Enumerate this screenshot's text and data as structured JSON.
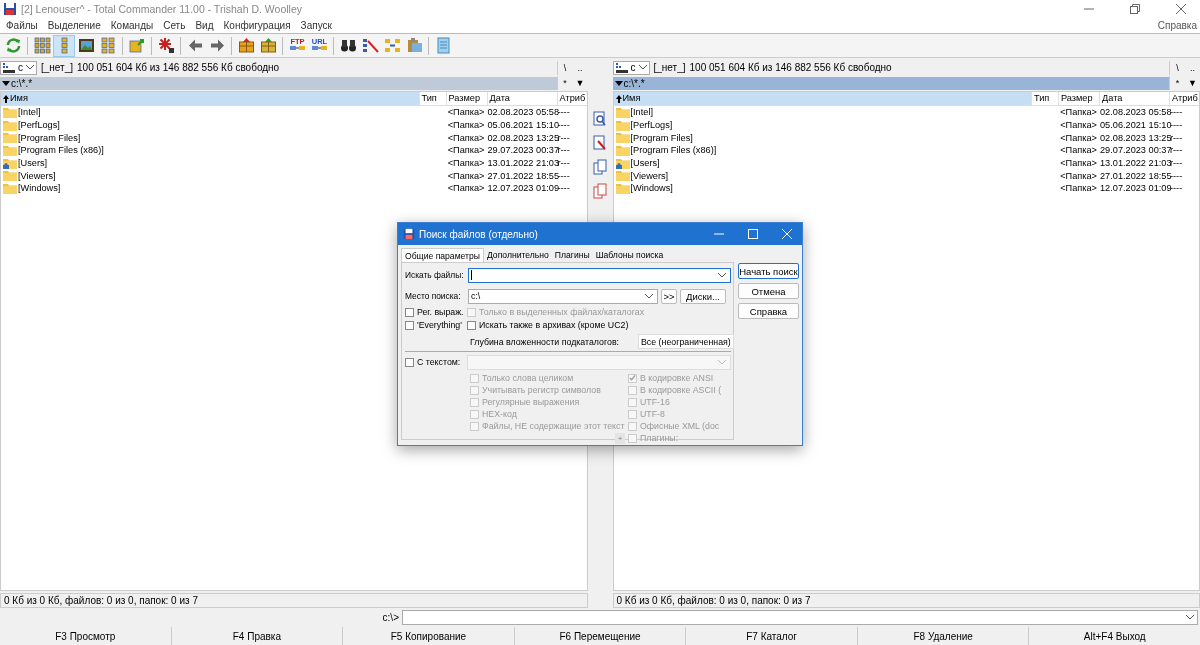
{
  "window": {
    "title": "[2] Lenouser^ - Total Commander 11.00 - Trishah D. Woolley"
  },
  "menu": [
    "Файлы",
    "Выделение",
    "Команды",
    "Сеть",
    "Вид",
    "Конфигурация",
    "Запуск"
  ],
  "help_menu": "Справка",
  "toolbar": [
    {
      "kind": "refresh",
      "selected": false
    },
    {
      "kind": "separator"
    },
    {
      "kind": "brief",
      "selected": false
    },
    {
      "kind": "detailed",
      "selected": true
    },
    {
      "kind": "thumbs",
      "selected": false
    },
    {
      "kind": "tree",
      "selected": false
    },
    {
      "kind": "separator"
    },
    {
      "kind": "syncfolder",
      "selected": false
    },
    {
      "kind": "separator"
    },
    {
      "kind": "rename",
      "selected": false
    },
    {
      "kind": "separator"
    },
    {
      "kind": "back",
      "selected": false
    },
    {
      "kind": "forward",
      "selected": false
    },
    {
      "kind": "separator"
    },
    {
      "kind": "pack",
      "selected": false
    },
    {
      "kind": "unpack",
      "selected": false
    },
    {
      "kind": "separator"
    },
    {
      "kind": "ftp",
      "label": "FTP",
      "selected": false
    },
    {
      "kind": "url",
      "label": "URL",
      "selected": false
    },
    {
      "kind": "separator"
    },
    {
      "kind": "find",
      "selected": false
    },
    {
      "kind": "compare",
      "selected": false
    },
    {
      "kind": "syncdirs",
      "selected": false
    },
    {
      "kind": "copynames",
      "selected": false
    },
    {
      "kind": "separator"
    },
    {
      "kind": "notepad",
      "selected": false
    }
  ],
  "panels": [
    {
      "active": false,
      "drive": "c",
      "volume": "[_нет_]",
      "free": "100 051 604 Кб из 146 882 556 Кб свободно",
      "root_button": "\\",
      "up_button": "..",
      "path": "c:\\*.*",
      "star_button": "*",
      "history_button": "▼",
      "columns": [
        "Имя",
        "Тип",
        "Размер",
        "Дата",
        "Атриб"
      ],
      "rows": [
        {
          "kind": "folder",
          "name": "[Intel]",
          "size": "<Папка>",
          "date": "02.08.2023 05:58",
          "attr": "----"
        },
        {
          "kind": "folder",
          "name": "[PerfLogs]",
          "size": "<Папка>",
          "date": "05.06.2021 15:10",
          "attr": "----"
        },
        {
          "kind": "folder",
          "name": "[Program Files]",
          "size": "<Папка>",
          "date": "02.08.2023 13:25",
          "attr": "r---"
        },
        {
          "kind": "folder",
          "name": "[Program Files (x86)]",
          "size": "<Папка>",
          "date": "29.07.2023 00:37",
          "attr": "r---"
        },
        {
          "kind": "user-folder",
          "name": "[Users]",
          "size": "<Папка>",
          "date": "13.01.2022 21:03",
          "attr": "r---"
        },
        {
          "kind": "folder",
          "name": "[Viewers]",
          "size": "<Папка>",
          "date": "27.01.2022 18:55",
          "attr": "----"
        },
        {
          "kind": "folder",
          "name": "[Windows]",
          "size": "<Папка>",
          "date": "12.07.2023 01:09",
          "attr": "----"
        }
      ],
      "status": "0 Кб из 0 Кб, файлов: 0 из 0, папок: 0 из 7"
    },
    {
      "active": true,
      "drive": "c",
      "volume": "[_нет_]",
      "free": "100 051 604 Кб из 146 882 556 Кб свободно",
      "root_button": "\\",
      "up_button": "..",
      "path": "c:\\*.*",
      "star_button": "*",
      "history_button": "▼",
      "columns": [
        "Имя",
        "Тип",
        "Размер",
        "Дата",
        "Атриб"
      ],
      "rows": [
        {
          "kind": "folder",
          "name": "[Intel]",
          "size": "<Папка>",
          "date": "02.08.2023 05:58",
          "attr": "----"
        },
        {
          "kind": "folder",
          "name": "[PerfLogs]",
          "size": "<Папка>",
          "date": "05.06.2021 15:10",
          "attr": "----"
        },
        {
          "kind": "folder",
          "name": "[Program Files]",
          "size": "<Папка>",
          "date": "02.08.2023 13:25",
          "attr": "r---"
        },
        {
          "kind": "folder",
          "name": "[Program Files (x86)]",
          "size": "<Папка>",
          "date": "29.07.2023 00:37",
          "attr": "r---"
        },
        {
          "kind": "user-folder",
          "name": "[Users]",
          "size": "<Папка>",
          "date": "13.01.2022 21:03",
          "attr": "r---"
        },
        {
          "kind": "folder",
          "name": "[Viewers]",
          "size": "<Папка>",
          "date": "27.01.2022 18:55",
          "attr": "----"
        },
        {
          "kind": "folder",
          "name": "[Windows]",
          "size": "<Папка>",
          "date": "12.07.2023 01:09",
          "attr": "----"
        }
      ],
      "status": "0 Кб из 0 Кб, файлов: 0 из 0, папок: 0 из 7"
    }
  ],
  "command_line": {
    "prompt": "c:\\>"
  },
  "function_keys": [
    "F3 Просмотр",
    "F4 Правка",
    "F5 Копирование",
    "F6 Перемещение",
    "F7 Каталог",
    "F8 Удаление",
    "Alt+F4 Выход"
  ],
  "dialog": {
    "title": "Поиск файлов (отдельно)",
    "tabs": [
      {
        "label": "Общие параметры",
        "selected": true
      },
      {
        "label": "Дополнительно",
        "selected": false
      },
      {
        "label": "Плагины",
        "selected": false
      },
      {
        "label": "Шаблоны поиска",
        "selected": false
      }
    ],
    "search_for": {
      "label": "Искать файлы:"
    },
    "search_in": {
      "label": "Место поиска:",
      "value": "c:\\"
    },
    "more_button": ">>",
    "drives_button": "Диски...",
    "left_checks": [
      {
        "label": "Рег. выраж.",
        "checked": false,
        "disabled": false
      },
      {
        "label": "'Everything'",
        "checked": false,
        "disabled": false
      }
    ],
    "right_checks": [
      {
        "label": "Только в выделенных файлах/каталогах",
        "checked": false,
        "disabled": true
      },
      {
        "label": "Искать также в архивах (кроме UC2)",
        "checked": false,
        "disabled": false
      }
    ],
    "depth": {
      "label": "Глубина вложенности подкаталогов:",
      "value": "Все (неограниченная)"
    },
    "text_check": {
      "label": "С текстом:",
      "checked": false,
      "disabled": false
    },
    "text_options": [
      {
        "label": "Только слова целиком",
        "checked": false,
        "disabled": true
      },
      {
        "label": "Учитывать регистр символов",
        "checked": false,
        "disabled": true
      },
      {
        "label": "Регулярные выражения",
        "checked": false,
        "disabled": true
      },
      {
        "label": "HEX-код",
        "checked": false,
        "disabled": true
      },
      {
        "label": "Файлы, НЕ содержащие этот текст",
        "checked": false,
        "disabled": true
      }
    ],
    "encodings": [
      {
        "label": "В кодировке ANSI",
        "checked": true,
        "disabled": true
      },
      {
        "label": "В кодировке ASCII (",
        "checked": false,
        "disabled": true
      },
      {
        "label": "UTF-16",
        "checked": false,
        "disabled": true
      },
      {
        "label": "UTF-8",
        "checked": false,
        "disabled": true
      },
      {
        "label": "Офисные XML (doc",
        "checked": false,
        "disabled": true
      },
      {
        "label": "Плагины:",
        "checked": false,
        "disabled": true
      }
    ],
    "plus_button": "+",
    "buttons": [
      {
        "label": "Начать поиск",
        "default": true
      },
      {
        "label": "Отмена",
        "default": false
      },
      {
        "label": "Справка",
        "default": false
      }
    ]
  }
}
